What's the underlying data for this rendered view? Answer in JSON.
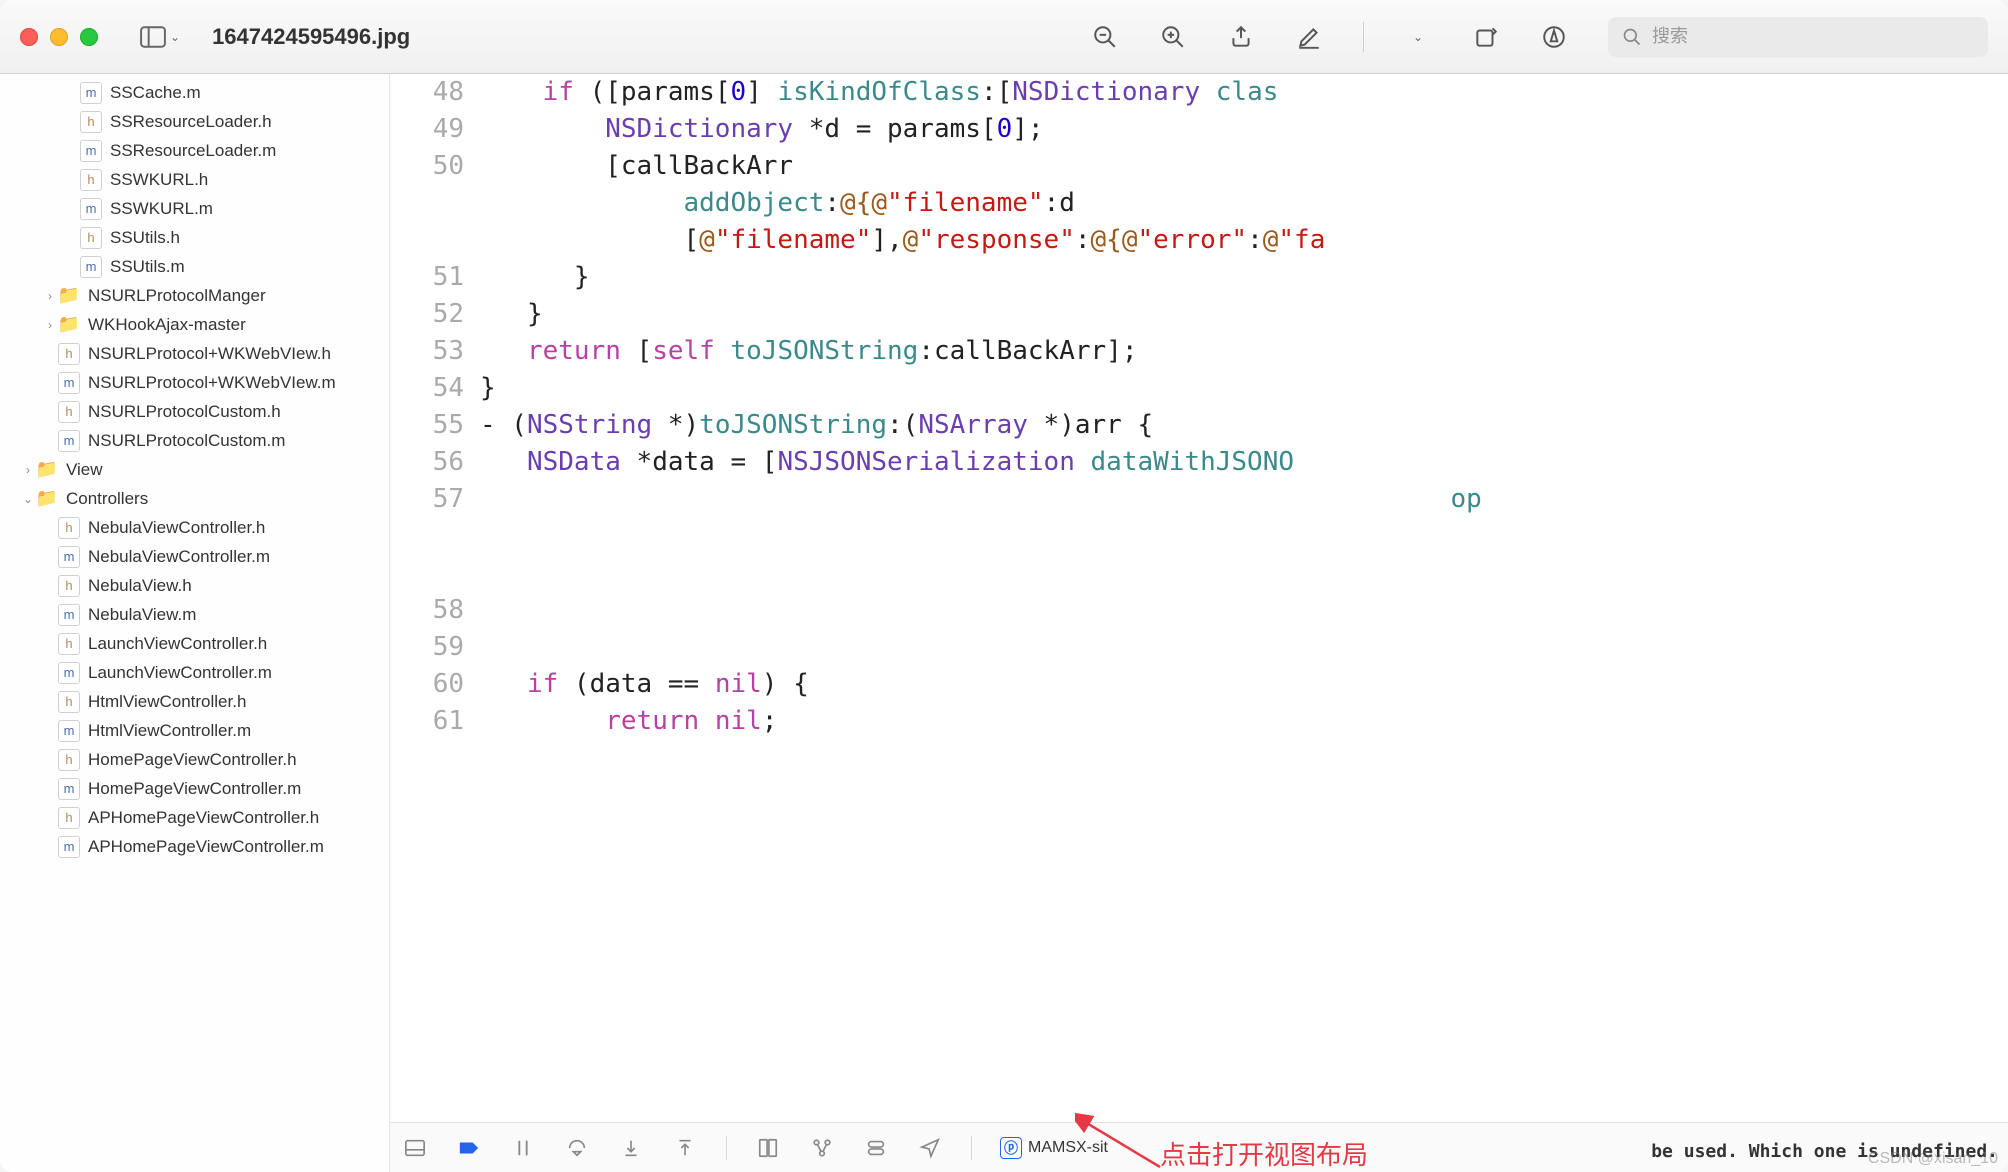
{
  "window": {
    "title": "1647424595496.jpg",
    "search_placeholder": "搜索"
  },
  "sidebar": {
    "items": [
      {
        "type": "m",
        "name": "SSCache.m",
        "indent": 2
      },
      {
        "type": "h",
        "name": "SSResourceLoader.h",
        "indent": 2
      },
      {
        "type": "m",
        "name": "SSResourceLoader.m",
        "indent": 2
      },
      {
        "type": "h",
        "name": "SSWKURL.h",
        "indent": 2
      },
      {
        "type": "m",
        "name": "SSWKURL.m",
        "indent": 2
      },
      {
        "type": "h",
        "name": "SSUtils.h",
        "indent": 2
      },
      {
        "type": "m",
        "name": "SSUtils.m",
        "indent": 2
      },
      {
        "type": "folder",
        "name": "NSURLProtocolManger",
        "indent": 1,
        "disclosure": "closed"
      },
      {
        "type": "folder",
        "name": "WKHookAjax-master",
        "indent": 1,
        "disclosure": "closed"
      },
      {
        "type": "h",
        "name": "NSURLProtocol+WKWebVIew.h",
        "indent": 1
      },
      {
        "type": "m",
        "name": "NSURLProtocol+WKWebVIew.m",
        "indent": 1
      },
      {
        "type": "h",
        "name": "NSURLProtocolCustom.h",
        "indent": 1
      },
      {
        "type": "m",
        "name": "NSURLProtocolCustom.m",
        "indent": 1
      },
      {
        "type": "folder",
        "name": "View",
        "indent": 0,
        "disclosure": "closed"
      },
      {
        "type": "folder",
        "name": "Controllers",
        "indent": 0,
        "disclosure": "open"
      },
      {
        "type": "h",
        "name": "NebulaViewController.h",
        "indent": 1
      },
      {
        "type": "m",
        "name": "NebulaViewController.m",
        "indent": 1
      },
      {
        "type": "h",
        "name": "NebulaView.h",
        "indent": 1
      },
      {
        "type": "m",
        "name": "NebulaView.m",
        "indent": 1
      },
      {
        "type": "h",
        "name": "LaunchViewController.h",
        "indent": 1
      },
      {
        "type": "m",
        "name": "LaunchViewController.m",
        "indent": 1
      },
      {
        "type": "h",
        "name": "HtmlViewController.h",
        "indent": 1
      },
      {
        "type": "m",
        "name": "HtmlViewController.m",
        "indent": 1
      },
      {
        "type": "h",
        "name": "HomePageViewController.h",
        "indent": 1
      },
      {
        "type": "m",
        "name": "HomePageViewController.m",
        "indent": 1
      },
      {
        "type": "h",
        "name": "APHomePageViewController.h",
        "indent": 1
      },
      {
        "type": "m",
        "name": "APHomePageViewController.m",
        "indent": 1
      }
    ]
  },
  "code": {
    "lines": [
      {
        "num": "48",
        "tokens": [
          {
            "t": "    ",
            "c": ""
          },
          {
            "t": "if",
            "c": "kw"
          },
          {
            "t": " ([params[",
            "c": ""
          },
          {
            "t": "0",
            "c": "num"
          },
          {
            "t": "] ",
            "c": ""
          },
          {
            "t": "isKindOfClass",
            "c": "method"
          },
          {
            "t": ":[",
            "c": ""
          },
          {
            "t": "NSDictionary",
            "c": "type"
          },
          {
            "t": " ",
            "c": ""
          },
          {
            "t": "clas",
            "c": "method"
          }
        ]
      },
      {
        "num": "49",
        "tokens": [
          {
            "t": "        ",
            "c": ""
          },
          {
            "t": "NSDictionary",
            "c": "type"
          },
          {
            "t": " *d = params[",
            "c": ""
          },
          {
            "t": "0",
            "c": "num"
          },
          {
            "t": "];",
            "c": ""
          }
        ]
      },
      {
        "num": "50",
        "tokens": [
          {
            "t": "        [callBackArr",
            "c": ""
          }
        ]
      },
      {
        "num": "",
        "tokens": [
          {
            "t": "             ",
            "c": ""
          },
          {
            "t": "addObject",
            "c": "method"
          },
          {
            "t": ":",
            "c": ""
          },
          {
            "t": "@{@",
            "c": "at"
          },
          {
            "t": "\"filename\"",
            "c": "str"
          },
          {
            "t": ":d",
            "c": ""
          }
        ]
      },
      {
        "num": "",
        "tokens": [
          {
            "t": "             [",
            "c": ""
          },
          {
            "t": "@",
            "c": "at"
          },
          {
            "t": "\"filename\"",
            "c": "str"
          },
          {
            "t": "],",
            "c": ""
          },
          {
            "t": "@",
            "c": "at"
          },
          {
            "t": "\"response\"",
            "c": "str"
          },
          {
            "t": ":",
            "c": ""
          },
          {
            "t": "@{@",
            "c": "at"
          },
          {
            "t": "\"error\"",
            "c": "str"
          },
          {
            "t": ":",
            "c": ""
          },
          {
            "t": "@",
            "c": "at"
          },
          {
            "t": "\"fa",
            "c": "str"
          }
        ]
      },
      {
        "num": "51",
        "tokens": [
          {
            "t": "      }",
            "c": ""
          }
        ]
      },
      {
        "num": "52",
        "tokens": [
          {
            "t": "   }",
            "c": ""
          }
        ]
      },
      {
        "num": "53",
        "tokens": [
          {
            "t": "   ",
            "c": ""
          },
          {
            "t": "return",
            "c": "kw"
          },
          {
            "t": " [",
            "c": ""
          },
          {
            "t": "self",
            "c": "kw"
          },
          {
            "t": " ",
            "c": ""
          },
          {
            "t": "toJSONString",
            "c": "method"
          },
          {
            "t": ":callBackArr];",
            "c": ""
          }
        ]
      },
      {
        "num": "54",
        "tokens": [
          {
            "t": "}",
            "c": ""
          }
        ]
      },
      {
        "num": "55",
        "tokens": [
          {
            "t": "- (",
            "c": ""
          },
          {
            "t": "NSString",
            "c": "type"
          },
          {
            "t": " *)",
            "c": ""
          },
          {
            "t": "toJSONString",
            "c": "method"
          },
          {
            "t": ":(",
            "c": ""
          },
          {
            "t": "NSArray",
            "c": "type"
          },
          {
            "t": " *)arr {",
            "c": ""
          }
        ]
      },
      {
        "num": "56",
        "tokens": [
          {
            "t": "   ",
            "c": ""
          },
          {
            "t": "NSData",
            "c": "type"
          },
          {
            "t": " *data = [",
            "c": ""
          },
          {
            "t": "NSJSONSerialization",
            "c": "type"
          },
          {
            "t": " ",
            "c": ""
          },
          {
            "t": "dataWithJSONO",
            "c": "method"
          }
        ]
      },
      {
        "num": "57",
        "tokens": [
          {
            "t": "                                                              ",
            "c": ""
          },
          {
            "t": "op",
            "c": "method"
          }
        ]
      },
      {
        "num": "",
        "tokens": [
          {
            "t": " ",
            "c": ""
          }
        ]
      },
      {
        "num": "",
        "tokens": [
          {
            "t": " ",
            "c": ""
          }
        ]
      },
      {
        "num": "58",
        "tokens": [
          {
            "t": " ",
            "c": ""
          }
        ]
      },
      {
        "num": "59",
        "tokens": [
          {
            "t": " ",
            "c": ""
          }
        ]
      },
      {
        "num": "60",
        "tokens": [
          {
            "t": "   ",
            "c": ""
          },
          {
            "t": "if",
            "c": "kw"
          },
          {
            "t": " (data == ",
            "c": ""
          },
          {
            "t": "nil",
            "c": "kw"
          },
          {
            "t": ") {",
            "c": ""
          }
        ]
      },
      {
        "num": "61",
        "tokens": [
          {
            "t": "        ",
            "c": ""
          },
          {
            "t": "return",
            "c": "kw"
          },
          {
            "t": " ",
            "c": ""
          },
          {
            "t": "nil",
            "c": "kw"
          },
          {
            "t": ";",
            "c": ""
          }
        ]
      }
    ]
  },
  "bottom": {
    "app_name": "MAMSX-sit",
    "console_line1": "be used. Which one is undefined.",
    "annotation_text": "点击打开视图布局",
    "watermark": "CSDN @xisan_10"
  }
}
